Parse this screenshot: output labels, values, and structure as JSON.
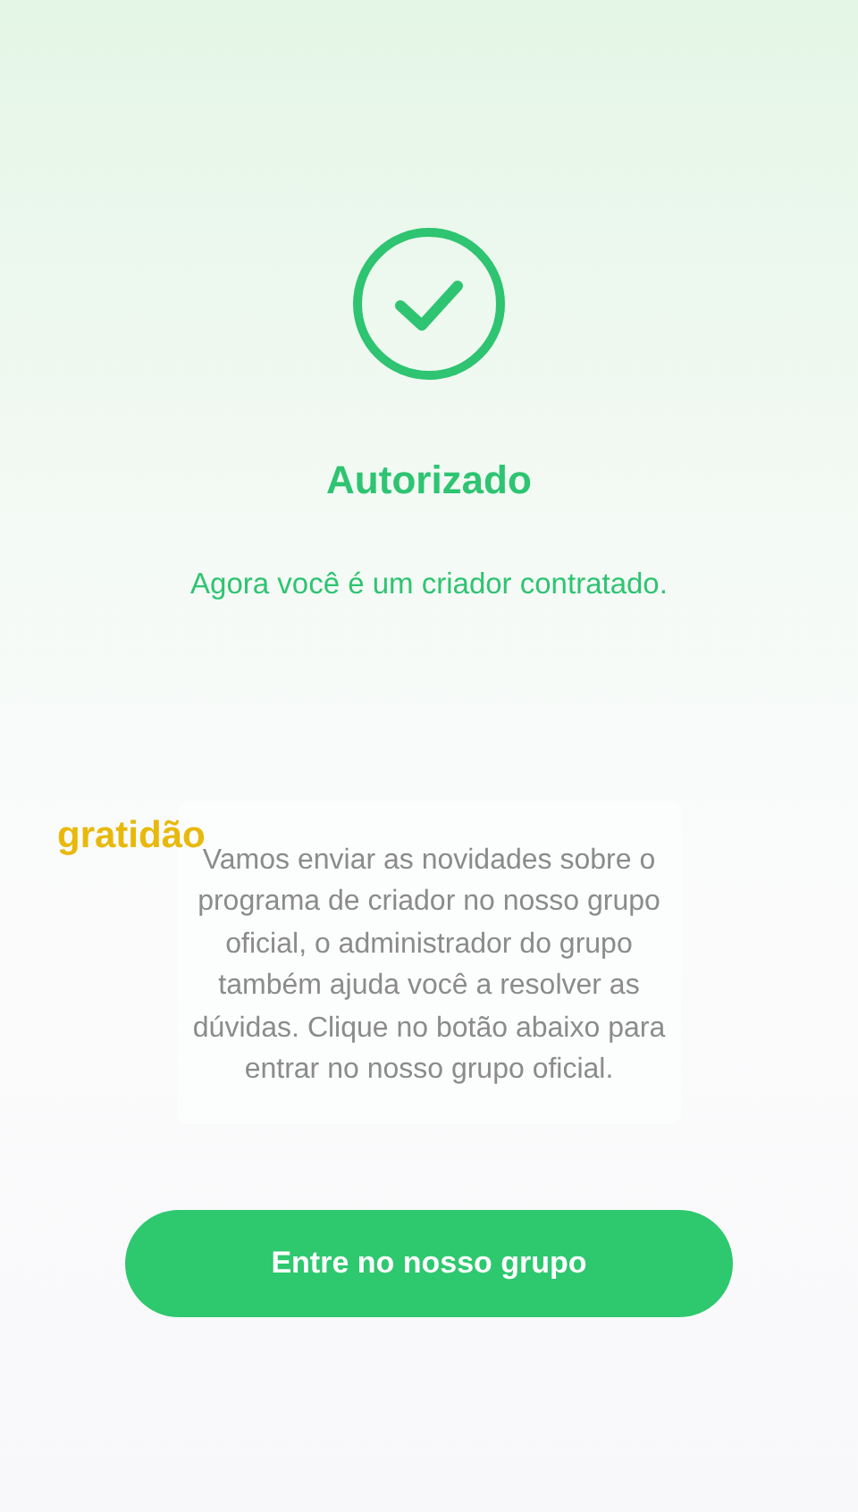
{
  "status": {
    "title": "Autorizado",
    "message": "Agora você é um criador contratado."
  },
  "caption": "gratidão",
  "info_card": {
    "text": "Vamos enviar as novidades sobre o programa de criador no nosso grupo oficial, o administrador do grupo também ajuda você a resolver as dúvidas. Clique no botão abaixo para entrar no nosso grupo oficial."
  },
  "buttons": [
    {
      "label": "Entre no nosso grupo",
      "kind": "primary"
    }
  ]
}
